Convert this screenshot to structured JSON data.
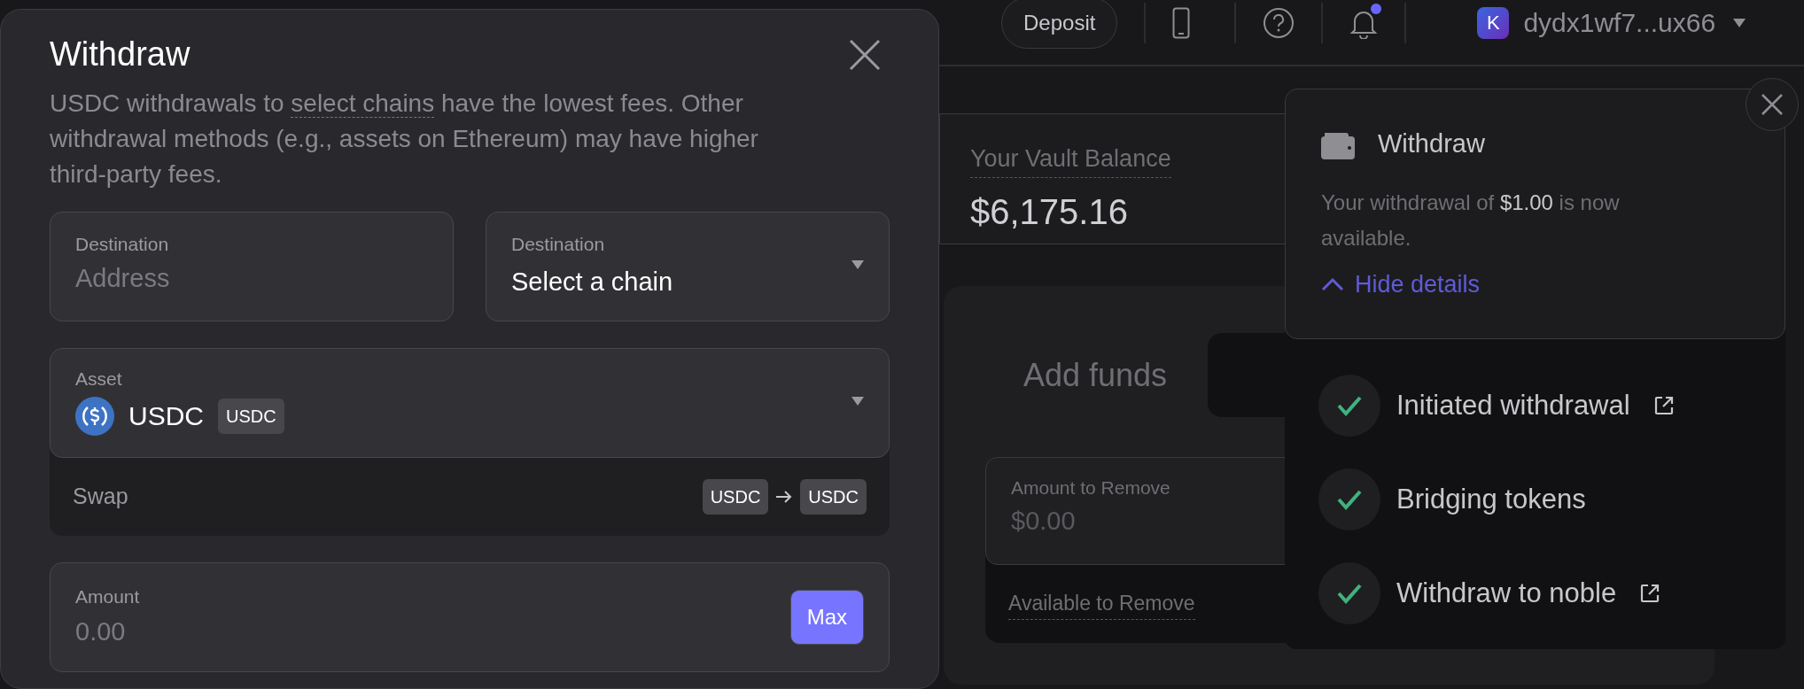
{
  "topbar": {
    "deposit_button": "Deposit",
    "notification_unread": true,
    "account": {
      "avatar": "K",
      "address": "dydx1wf7...ux66"
    }
  },
  "vault": {
    "label": "Your Vault Balance",
    "balance": "$6,175.16"
  },
  "funds_panel": {
    "tabs": [
      {
        "label": "Add funds",
        "selected": false
      },
      {
        "selected": true
      }
    ],
    "amount_field": {
      "label": "Amount to Remove",
      "placeholder": "$0.00"
    },
    "available_label": "Available to Remove"
  },
  "modal": {
    "title": "Withdraw",
    "notice": {
      "before": "USDC withdrawals to ",
      "link": "select chains",
      "after": " have the lowest fees. Other withdrawal methods (e.g., assets on Ethereum) may have higher third-party fees."
    },
    "destination_address": {
      "label": "Destination",
      "placeholder": "Address"
    },
    "destination_chain": {
      "label": "Destination",
      "value": "Select a chain"
    },
    "asset": {
      "label": "Asset",
      "value": "USDC",
      "tag": "USDC"
    },
    "swap": {
      "label": "Swap",
      "from": "USDC",
      "to": "USDC"
    },
    "amount": {
      "label": "Amount",
      "placeholder": "0.00",
      "button": "Max"
    }
  },
  "toast": {
    "title": "Withdraw",
    "message": "Your withdrawal of **$1.00** is now available.",
    "toggle": "Hide details",
    "expanded": true,
    "steps": [
      {
        "label": "Initiated withdrawal",
        "done": true,
        "link": true
      },
      {
        "label": "Bridging tokens",
        "done": true,
        "link": false
      },
      {
        "label": "Withdraw to noble",
        "done": true,
        "link": true
      }
    ]
  }
}
